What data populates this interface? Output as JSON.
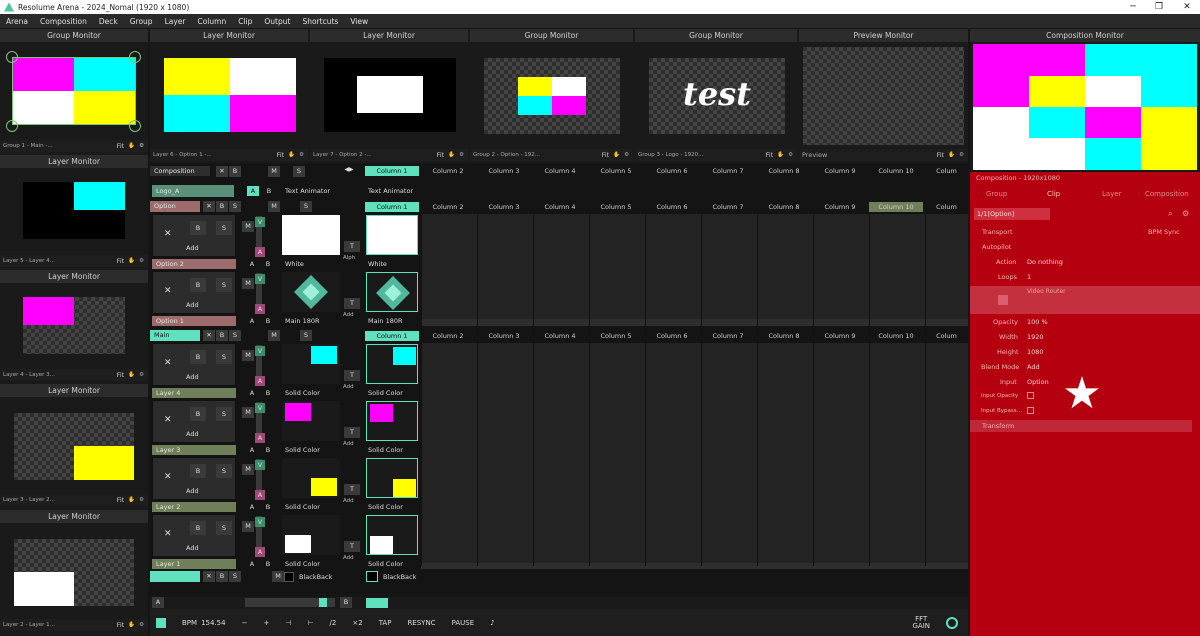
{
  "titlebar": {
    "title": "Resolume Arena - 2024_Nomal (1920 x 1080)",
    "min": "─",
    "max": "❐",
    "close": "✕"
  },
  "menu": [
    "Arena",
    "Composition",
    "Deck",
    "Group",
    "Layer",
    "Column",
    "Clip",
    "Output",
    "Shortcuts",
    "View"
  ],
  "left_monitors": [
    {
      "title": "Group Monitor",
      "caption": "Group 1 - Main -..."
    },
    {
      "title": "Layer Monitor",
      "caption": "Layer 5 - Layer 4..."
    },
    {
      "title": "Layer Monitor",
      "caption": "Layer 4 - Layer 3..."
    },
    {
      "title": "Layer Monitor",
      "caption": "Layer 3 - Layer 2..."
    },
    {
      "title": "Layer Monitor",
      "caption": "Layer 2 - Layer 1..."
    }
  ],
  "fit": "Fit",
  "top_monitors": [
    {
      "title": "Layer Monitor",
      "caption": "Layer 6 - Option 1 -..."
    },
    {
      "title": "Layer Monitor",
      "caption": "Layer 7 - Option 2 -..."
    },
    {
      "title": "Group Monitor",
      "caption": "Group 2 - Option - 192..."
    },
    {
      "title": "Group Monitor",
      "caption": "Group 3 - Logo - 1920..."
    },
    {
      "title": "Preview Monitor",
      "caption": "Preview"
    },
    {
      "title": "Composition Monitor"
    }
  ],
  "test_text": "test",
  "composition_label": "Composition",
  "text_animator": "Text Animator",
  "logo_a": "Logo_A",
  "columns": [
    "Column 1",
    "Column 2",
    "Column 3",
    "Column 4",
    "Column 5",
    "Column 6",
    "Column 7",
    "Column 8",
    "Column 9",
    "Column 10",
    "Colum"
  ],
  "groups": {
    "option": "Option",
    "main": "Main"
  },
  "layers": [
    {
      "name": "Option 2",
      "clip": "White",
      "clip1": "White"
    },
    {
      "name": "Option 1",
      "clip": "Main 180R",
      "clip1": "Main 180R"
    },
    {
      "name": "Layer 4",
      "clip": "Solid Color",
      "clip1": "Solid Color"
    },
    {
      "name": "Layer 3",
      "clip": "Solid Color",
      "clip1": "Solid Color"
    },
    {
      "name": "Layer 2",
      "clip": "Solid Color",
      "clip1": "Solid Color"
    },
    {
      "name": "Layer 1",
      "clip": "Solid Color",
      "clip1": "Solid Color"
    }
  ],
  "blackback": "BlackBack",
  "labels": {
    "add": "Add",
    "b": "B",
    "s": "S",
    "m": "M",
    "v": "V",
    "a": "A",
    "t": "T",
    "x": "✕",
    "alph": "Alph"
  },
  "bottom": {
    "bpm_label": "BPM",
    "bpm": "154.54",
    "minus": "−",
    "plus": "+",
    "half": "/2",
    "double": "×2",
    "tap": "TAP",
    "resync": "RESYNC",
    "pause": "PAUSE",
    "fft": "FFT",
    "gain": "GAIN"
  },
  "right_panel": {
    "title": "Composition - 1920x1080",
    "tabs": [
      "Group",
      "Clip",
      "Layer",
      "Composition"
    ],
    "clip_name": "1/1[Option]",
    "transport": "Transport",
    "bpm_sync": "BPM Sync",
    "autopilot": "Autopilot",
    "action_label": "Action",
    "action_value": "Do nothing",
    "loops_label": "Loops",
    "loops_value": "1",
    "video_router": "Video Router",
    "opacity_label": "Opacity",
    "opacity_value": "100 %",
    "width_label": "Width",
    "width_value": "1920",
    "height_label": "Height",
    "height_value": "1080",
    "blend_label": "Blend Mode",
    "blend_value": "Add",
    "input_label": "Input",
    "input_value": "Option",
    "input_opacity": "Input Opacity",
    "input_bypass": "Input Bypass...",
    "transform": "Transform",
    "star": "★"
  },
  "colors": {
    "teal": "#5fe0bf",
    "magenta": "#ff00ff",
    "cyan": "#00ffff",
    "yellow": "#ffff00",
    "red_panel": "#b50010"
  }
}
